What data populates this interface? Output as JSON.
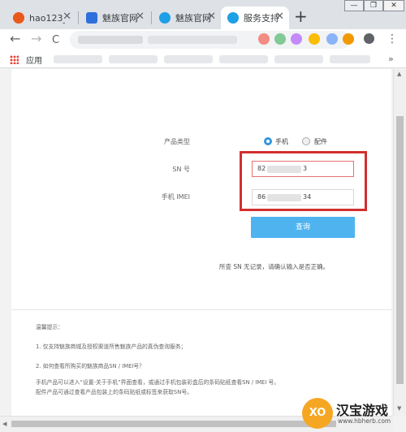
{
  "browser": {
    "tabs": [
      {
        "title": "hao123_",
        "icon": "hao123-icon",
        "icon_color": "#e8591a"
      },
      {
        "title": "魅族官网",
        "icon": "paw-icon",
        "icon_color": "#2f6fdc"
      },
      {
        "title": "魅族官网",
        "icon": "meizu-icon",
        "icon_color": "#1ea0e6"
      },
      {
        "title": "服务支持",
        "icon": "meizu-icon",
        "icon_color": "#1ea0e6",
        "active": true
      }
    ],
    "new_tab": "+",
    "window_controls": {
      "minimize": "—",
      "restore": "❐",
      "close": "✕"
    },
    "nav": {
      "back": "←",
      "forward": "→",
      "reload": "C"
    },
    "menu": "⋮",
    "bookmarks": {
      "apps_label": "应用",
      "more": "»"
    }
  },
  "form": {
    "product_type_label": "产品类型",
    "option_phone": "手机",
    "option_accessory": "配件",
    "selected": "手机",
    "sn_label": "SN 号",
    "sn_value_prefix": "82",
    "sn_value_suffix": "3",
    "imei_label": "手机 IMEI",
    "imei_value_prefix": "86",
    "imei_value_suffix": "34",
    "query_button": "查询",
    "error_note": "所查 SN 无记录，请确认输入是否正确。"
  },
  "tips": {
    "heading": "温馨提示：",
    "line1": "1. 仅支持魅族商城及授权渠道所售魅族产品的真伪查询服务；",
    "line2": "2. 如何查看所购买的魅族商品SN / IMEI号？",
    "line3": "手机产品可以进入“设置-关于手机”界面查看，或通过手机包装彩盒后的条码贴纸查看SN / IMEI 号。",
    "line4": "配件产品可通过查看产品包装上的条码贴纸或标签来获取SN号。"
  },
  "watermark": {
    "logo_text": "XO",
    "title": "汉宝游戏",
    "url": "www.hbherb.com"
  },
  "colors": {
    "accent": "#4fb3f0",
    "radio_selected": "#3498db",
    "highlight_box": "#d32f2f"
  }
}
